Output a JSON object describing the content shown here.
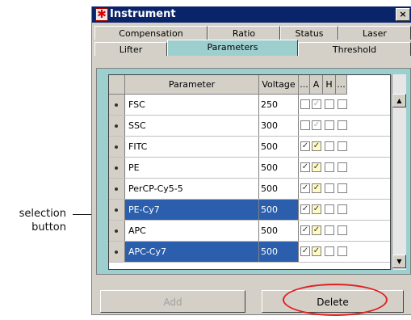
{
  "callout": {
    "line1": "selection",
    "line2": "button"
  },
  "window": {
    "title": "Instrument",
    "close_glyph": "×",
    "icon": "app-asterisk-icon"
  },
  "tabs_row1": [
    "Compensation",
    "Ratio",
    "Status",
    "Laser"
  ],
  "tabs_row2": [
    "Lifter",
    "Parameters",
    "Threshold"
  ],
  "active_tab": "Parameters",
  "grid": {
    "headers": {
      "parameter": "Parameter",
      "voltage": "Voltage",
      "col_dots1": "...",
      "col_a": "A",
      "col_h": "H",
      "col_dots2": "..."
    },
    "rows": [
      {
        "parameter": "FSC",
        "voltage": "250",
        "c1": false,
        "a": true,
        "a_disabled": true,
        "h": false,
        "c2": false,
        "selected": false
      },
      {
        "parameter": "SSC",
        "voltage": "300",
        "c1": false,
        "a": true,
        "a_disabled": true,
        "h": false,
        "c2": false,
        "selected": false
      },
      {
        "parameter": "FITC",
        "voltage": "500",
        "c1": true,
        "a": true,
        "a_disabled": false,
        "h": false,
        "c2": false,
        "selected": false
      },
      {
        "parameter": "PE",
        "voltage": "500",
        "c1": true,
        "a": true,
        "a_disabled": false,
        "h": false,
        "c2": false,
        "selected": false
      },
      {
        "parameter": "PerCP-Cy5-5",
        "voltage": "500",
        "c1": true,
        "a": true,
        "a_disabled": false,
        "h": false,
        "c2": false,
        "selected": false
      },
      {
        "parameter": "PE-Cy7",
        "voltage": "500",
        "c1": true,
        "a": true,
        "a_disabled": false,
        "h": false,
        "c2": false,
        "selected": true
      },
      {
        "parameter": "APC",
        "voltage": "500",
        "c1": true,
        "a": true,
        "a_disabled": false,
        "h": false,
        "c2": false,
        "selected": false
      },
      {
        "parameter": "APC-Cy7",
        "voltage": "500",
        "c1": true,
        "a": true,
        "a_disabled": false,
        "h": false,
        "c2": false,
        "selected": true
      }
    ]
  },
  "buttons": {
    "add": "Add",
    "delete": "Delete"
  },
  "colors": {
    "selection": "#2b5fad",
    "highlight_ellipse": "#e02020",
    "titlebar": "#0a246a"
  }
}
